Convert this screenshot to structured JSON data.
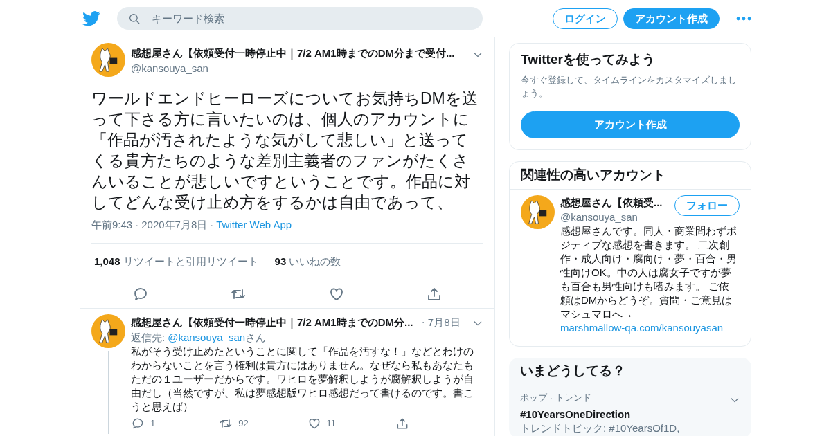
{
  "header": {
    "search": {
      "placeholder": "キーワード検索"
    },
    "buttons": [
      {
        "label": "ログイン",
        "kind": "outline"
      },
      {
        "label": "アカウント作成",
        "kind": "solid"
      }
    ]
  },
  "tweet": {
    "name": "感想屋さん【依頼受付一時停止中｜7/2 AM1時までのDM分まで受付...",
    "handle": "@kansouya_san",
    "text": "ワールドエンドヒーローズについてお気持ちDMを送って下さる方に言いたいのは、個人のアカウントに「作品が汚されたような気がして悲しい」と送ってくる貴方たちのような差別主義者のファンがたくさんいることが悲しいですということです。作品に対してどんな受け止め方をするかは自由であって、",
    "time": "午前9:43",
    "separator": "·",
    "date": "2020年7月8日",
    "source": "Twitter Web App",
    "stats": [
      {
        "count": "1,048",
        "label": "リツイートと引用リツイート"
      },
      {
        "count": "93",
        "label": "いいねの数"
      }
    ]
  },
  "reply": {
    "name": "感想屋さん【依頼受付一時停止中｜7/2 AM1時までのDM分...",
    "separator": "·",
    "date": "7月8日",
    "reply_to_label": "返信先:",
    "reply_to": "@kansouya_san",
    "reply_to_suffix": "さん",
    "text": "私がそう受け止めたということに関して「作品を汚すな！」などとわけのわからないことを言う権利は貴方にはありません。なぜなら私もあなたもただの１ユーザーだからです。ワヒロを夢解釈しようが腐解釈しようが自由だし（当然ですが、私は夢感想版ワヒロ感想だって書けるのです。書こうと思えば）",
    "actions": [
      {
        "kind": "reply",
        "count": "1"
      },
      {
        "kind": "retweet",
        "count": "92"
      },
      {
        "kind": "like",
        "count": "11"
      },
      {
        "kind": "share"
      }
    ]
  },
  "signup_card": {
    "title": "Twitterを使ってみよう",
    "text": "今すぐ登録して、タイムラインをカスタマイズしましょう。",
    "button": "アカウント作成"
  },
  "related_card": {
    "title": "関連性の高いアカウント",
    "name": "感想屋さん【依頼受...",
    "handle": "@kansouya_san",
    "button": "フォロー",
    "bio": "感想屋さんです。同人・商業問わずポジティブな感想を書きます。 二次創作・成人向け・腐向け・夢・百合・男性向けOK。中の人は腐女子ですが夢も百合も男性向けも嗜みます。 ご依頼はDMからどうぞ。質問・ご意見はマシュマロへ→",
    "link": "marshmallow-qa.com/kansouyasan"
  },
  "trends_card": {
    "title": "いまどうしてる？",
    "trends": [
      {
        "category": "ポップ · トレンド",
        "name": "#10YearsOneDirection",
        "detail": "トレンドトピック: #10YearsOf1D,"
      }
    ]
  }
}
